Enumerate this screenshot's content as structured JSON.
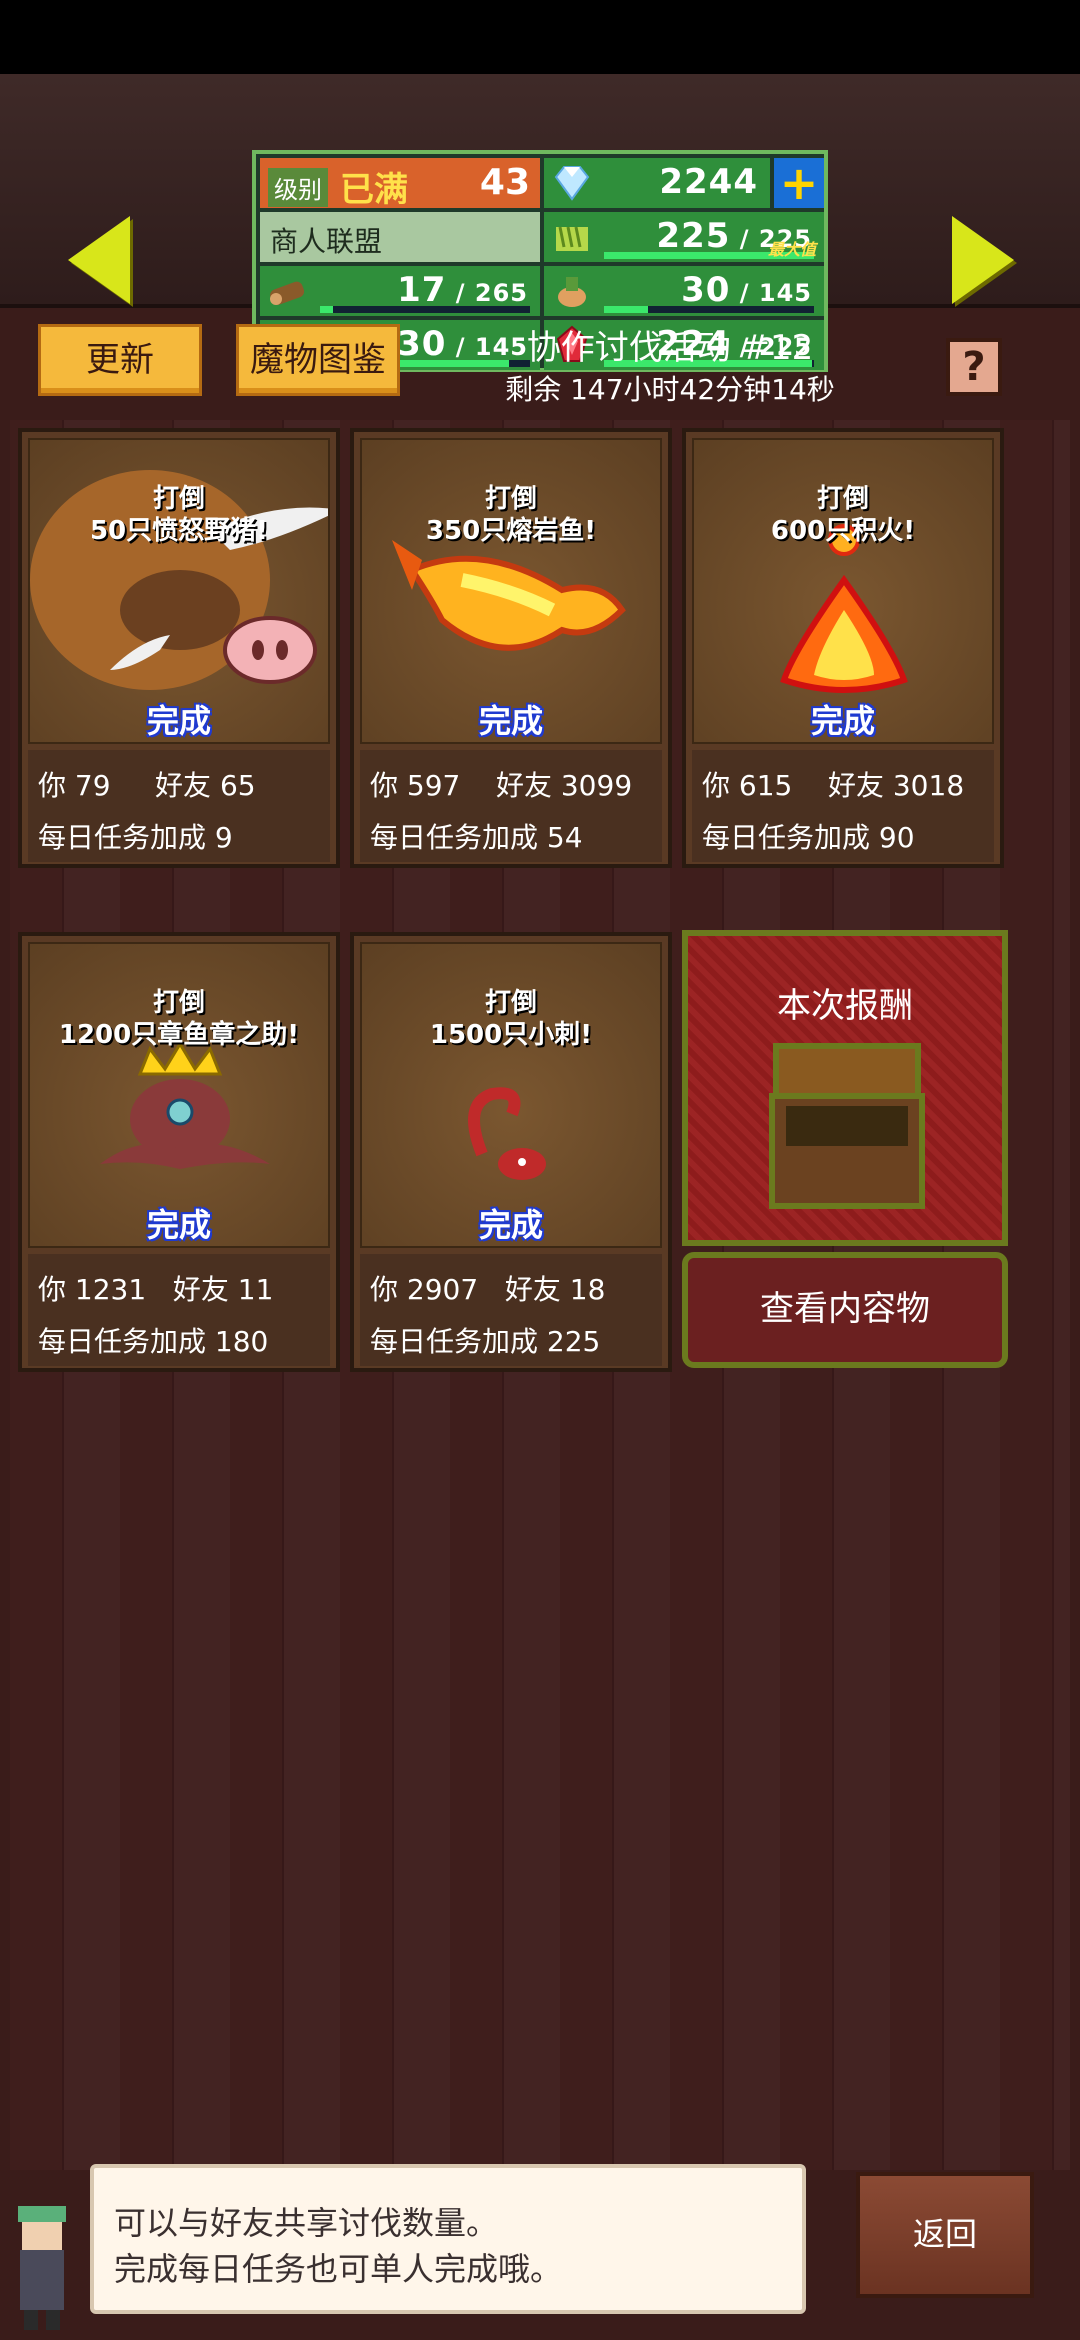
{
  "hud": {
    "level_label": "级别",
    "level_status": "已满",
    "level_value": "43",
    "gems": "2244",
    "plus_label": "+",
    "guild_name": "商人联盟",
    "grass_current": "225",
    "grass_max": "225",
    "max_tag": "最大值",
    "wood_current": "17",
    "wood_max": "265",
    "food_current": "30",
    "food_max": "145",
    "ore_current": "130",
    "ore_max": "145",
    "ruby_current": "224",
    "ruby_max": "225",
    "fill": {
      "wood": 0.06,
      "food": 0.21,
      "ore": 0.9,
      "ruby": 0.99,
      "grass": 1.0
    }
  },
  "controls": {
    "refresh_label": "更新",
    "monster_book_label": "魔物图鉴",
    "event_title": "协作讨伐活动 #12",
    "event_timer": "剩余 147小时42分钟14秒",
    "help_label": "?"
  },
  "cards": [
    {
      "line1": "打倒",
      "line2": "50只愤怒野猪!",
      "done": "完成",
      "you": "你  79",
      "friend": "好友  65",
      "bonus": "每日任务加成  9"
    },
    {
      "line1": "打倒",
      "line2": "350只熔岩鱼!",
      "done": "完成",
      "you": "你  597",
      "friend": "好友  3099",
      "bonus": "每日任务加成  54"
    },
    {
      "line1": "打倒",
      "line2": "600只积火!",
      "done": "完成",
      "you": "你  615",
      "friend": "好友  3018",
      "bonus": "每日任务加成  90"
    },
    {
      "line1": "打倒",
      "line2": "1200只章鱼章之助!",
      "done": "完成",
      "you": "你  1231",
      "friend": "好友  11",
      "bonus": "每日任务加成  180"
    },
    {
      "line1": "打倒",
      "line2": "1500只小刺!",
      "done": "完成",
      "you": "你  2907",
      "friend": "好友  18",
      "bonus": "每日任务加成  225"
    }
  ],
  "reward": {
    "title": "本次报酬",
    "view_label": "查看内容物"
  },
  "bottom": {
    "line1": "可以与好友共享讨伐数量。",
    "line2": "完成每日任务也可单人完成哦。",
    "back_label": "返回"
  },
  "icons": {
    "left_arrow": "left-arrow-icon",
    "right_arrow": "right-arrow-icon",
    "gem": "diamond-icon",
    "grass": "grass-icon",
    "wood": "wood-icon",
    "food": "food-icon",
    "ore": "ore-icon",
    "ruby": "ruby-icon",
    "chest": "treasure-chest-icon"
  },
  "colors": {
    "accent_yellow": "#f5b93c",
    "hud_green": "#2f8f3b",
    "done_blue": "#1f3ad0",
    "arrow_yellow": "#d8e61a"
  }
}
